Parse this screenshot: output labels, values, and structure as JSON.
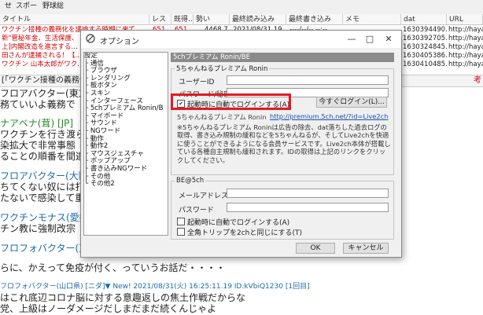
{
  "topbar": {
    "tabs": [
      "せ",
      "スポー",
      "野球総"
    ]
  },
  "thread_list": {
    "columns": [
      "タイトル",
      "レス",
      "既得..",
      "勢い",
      "最終読み込み",
      "最終書き込み",
      "メモ",
      "dat",
      "URL"
    ],
    "rows": [
      {
        "title": "ワクチン接種の義務化を議論する時期に来て…",
        "res": "651",
        "got": "651",
        "ikioi": "4468.7",
        "read": "2021/08/31 19...",
        "write": "----/--/-- --:--",
        "dat": "1630394490...",
        "url": "http://hayal"
      },
      {
        "title": "新\"菅秘年金、生活保護、",
        "dat": "1630392705...",
        "url": "http://hayal"
      },
      {
        "title": "上]内閣改造を進言する…",
        "dat": "1630324845...",
        "url": "http://hayal"
      },
      {
        "title": "田さんが逮捕される！【…",
        "dat": "1630405386...",
        "url": "http://hayal"
      },
      {
        "title": "ワクチン 山本太郎がワク…",
        "dat": "1630410485...",
        "url": "http://hayal"
      }
    ]
  },
  "tab_bar": {
    "label": "[「ワクチン接種の義務化を",
    "right_label": "考"
  },
  "background_posts": [
    {
      "text": "フロアバクター(東京都",
      "cls": "g"
    },
    {
      "text": "務ていいよ義務で",
      "cls": ""
    },
    {
      "text": "ナアベナ(茸) [JP] ",
      "cls": "g"
    },
    {
      "text": "ワクチンを行き渡らせな",
      "cls": ""
    },
    {
      "text": "染拡大で非常事態",
      "cls": ""
    },
    {
      "text": "ることの順番を間違",
      "cls": ""
    },
    {
      "text": "フロアバクター(大阪府) [C",
      "cls": "g"
    },
    {
      "text": "ちてくない奴には打",
      "cls": ""
    },
    {
      "text": "たないで感染して重",
      "cls": ""
    },
    {
      "text": "ワクチンモナス(愛媛県) [C",
      "cls": "g"
    },
    {
      "text": "チン教に強制改宗",
      "cls": ""
    },
    {
      "text": "フロフォバクター(東京都",
      "cls": "g"
    },
    {
      "text": "らに、かえって免疫が付く、っていうお話だ・・・・",
      "cls": ""
    },
    {
      "text": "フロフォバクター(山口県) [ニダ]▼ New! 2021/08/31(火) 16:25:11.19 ID:kVbiQ1230 [1回目]",
      "cls": "g"
    },
    {
      "text": "はこれ底辺コロナ脳に対する意趣返しの焦土作戦だからな",
      "cls": ""
    },
    {
      "text": "党、上級はノーダメージだしまだまだ続くんじゃよ",
      "cls": ""
    }
  ],
  "dialog": {
    "title": "オプション",
    "tree": [
      "設定",
      "├ 通信",
      "├ ブラウザ",
      "├ レンダリング",
      "├ 板ボタン",
      "├ スキン",
      "├ インターフェース",
      "├ 5chプレミアム Ronin/B",
      "├ マイボード",
      "├ サウンド",
      "├ NGワード",
      "├ 動作",
      "├ 動作2",
      "├ マウスジェスチャ",
      "├ ポップアップ",
      "├ 書き込みNGワード",
      "├ その他",
      "└ その他2"
    ],
    "panel_header": "5chプレミアム Ronin/BE",
    "ronin": {
      "legend": "5ちゃんねるプレミアム Ronin",
      "user_id_label": "ユーザーID",
      "password_label": "パスワード/秘密鍵",
      "auto_login_label": "起動時に自動でログインする(A)",
      "auto_login_checked": true,
      "login_now_label": "今すぐログイン(L)...",
      "link_prefix": "5ちゃんねるプレミアム Ronin",
      "link": "http://premium.5ch.net/?id=Live2ch",
      "description": "※5ちゃんねるプレミアム Roninは広告の除去、dat落ちした過去ログの取得、書き込み規制の緩和などを5ちゃんねるが、そしてLive2chを快適に使うことができるようになる会員サービスです。Live2ch本体が搭載している各種自主規制も緩和されます。IDの取得は上記のリンクをクリックしてください。"
    },
    "be": {
      "legend": "BE@5ch",
      "mail_label": "メールアドレス",
      "password_label": "パスワード",
      "auto_login_label": "起動時に自動でログインする(A)",
      "trip_label": "全角トリップを2chと同じにする(T)"
    },
    "ok_label": "OK",
    "cancel_label": "キャンセル"
  },
  "colors": {
    "highlight": "#e01b24",
    "red_text": "#d10000",
    "panel_header": "#8b8b8b"
  }
}
